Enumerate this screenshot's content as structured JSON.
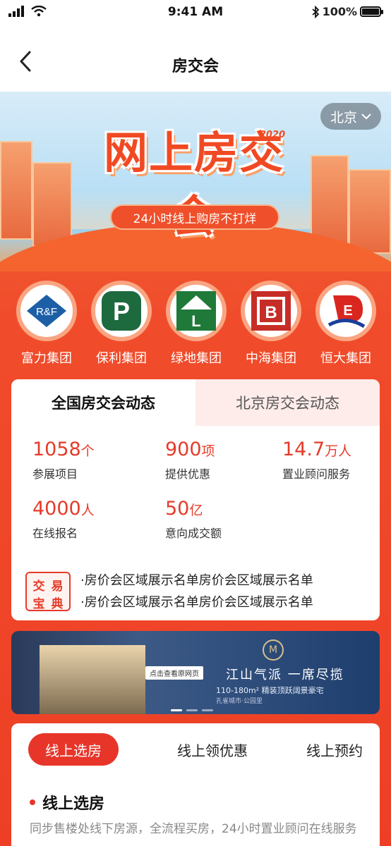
{
  "status_bar": {
    "time": "9:41 AM",
    "battery": "100%",
    "battery_level": 1.0
  },
  "nav": {
    "title": "房交会",
    "back_icon": "chevron-left-icon"
  },
  "hero": {
    "city": "北京",
    "headline": "网上房交会",
    "year": "2020",
    "tagline": "24小时线上购房不打烊"
  },
  "brands": [
    {
      "name": "富力集团",
      "logo_text": "R&F"
    },
    {
      "name": "保利集团",
      "logo_text": "P"
    },
    {
      "name": "绿地集团",
      "logo_text": "L"
    },
    {
      "name": "中海集团",
      "logo_text": "B"
    },
    {
      "name": "恒大集团",
      "logo_text": "E"
    }
  ],
  "tabs": {
    "national": "全国房交会动态",
    "local": "北京房交会动态"
  },
  "stats": [
    {
      "value": "1058",
      "unit": "个",
      "label": "参展项目"
    },
    {
      "value": "900",
      "unit": "项",
      "label": "提供优惠"
    },
    {
      "value": "14.7",
      "unit": "万人",
      "label": "置业顾问服务"
    },
    {
      "value": "4000",
      "unit": "人",
      "label": "在线报名"
    },
    {
      "value": "50",
      "unit": "亿",
      "label": "意向成交额"
    }
  ],
  "tips": {
    "badge": [
      "交",
      "易",
      "宝",
      "典"
    ],
    "lines": [
      "·房价会区域展示名单房价会区域展示名单",
      "·房价会区域展示名单房价会区域展示名单"
    ]
  },
  "banner": {
    "tag": "点击查看原网页",
    "crest": "M",
    "title": "江山气派 一席尽揽",
    "subtitle": "110-180m² 精装顶跃阔景豪宅",
    "small": "孔雀城市·公园里"
  },
  "bottom": {
    "segments": [
      "线上选房",
      "线上领优惠",
      "线上预约"
    ],
    "section_title": "线上选房",
    "section_desc": "同步售楼处线下房源，全流程买房，24小时置业顾问在线服务"
  },
  "colors": {
    "accent": "#e8352a",
    "hero_orange": "#f04a24"
  }
}
